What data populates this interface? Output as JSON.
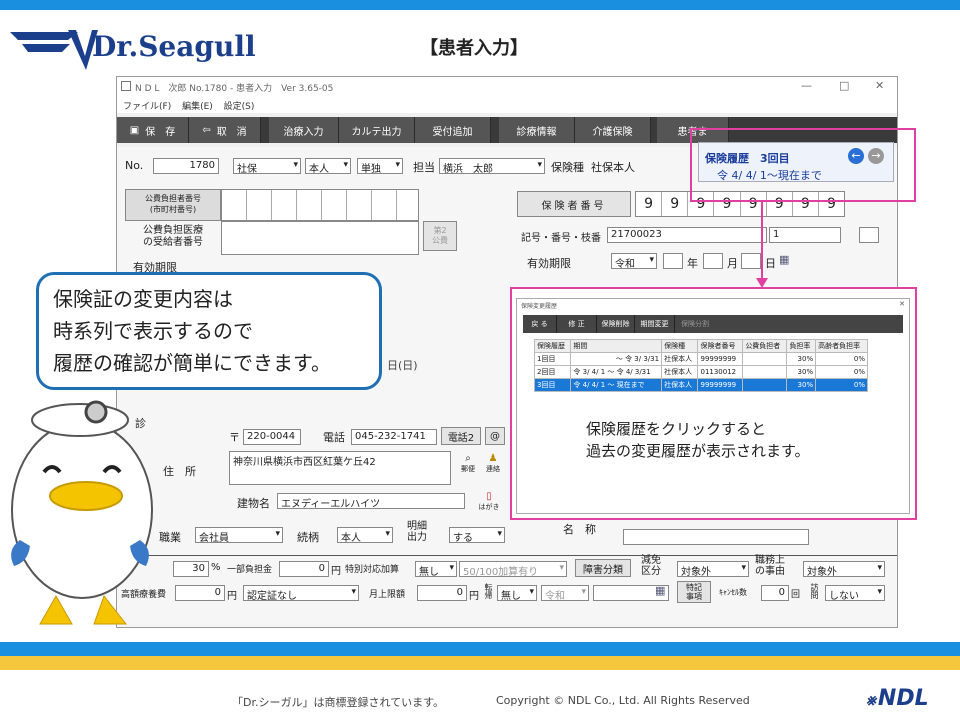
{
  "slide": {
    "title": "【患者入力】",
    "logo": "Dr.Seagull",
    "callout": [
      "保険証の変更内容は",
      "時系列で表示するので",
      "履歴の確認が簡単にできます。"
    ],
    "popup_note": [
      "保険履歴をクリックすると",
      "過去の変更履歴が表示されます。"
    ],
    "footer_left": "「Dr.シーガル」は商標登録されています。",
    "footer_copy": "Copyright © NDL Co., Ltd. All Rights Reserved",
    "footer_logo": "NDL"
  },
  "window": {
    "title": "N D L　次郎 No.1780 - 患者入力　Ver 3.65-05",
    "menu": [
      "ファイル(F)",
      "編集(E)",
      "設定(S)"
    ],
    "controls": [
      "—",
      "□",
      "✕"
    ]
  },
  "toolbar": [
    "保　存",
    "取　消",
    "治療入力",
    "カルテ出力",
    "受付追加",
    "診療情報",
    "介護保険",
    "患者ま"
  ],
  "form": {
    "no_label": "No.",
    "no_value": "1780",
    "insurance_kind": "社保",
    "self_family": "本人",
    "single": "単独",
    "tanto_label": "担当",
    "tanto_value": "横浜　太郎",
    "hokenshu_label": "保険種",
    "hokenshu_value": "社保本人",
    "kohi_no_label": "公費負担者番号\n(市町村番号)",
    "kohi_recipient_label": "公費負担医療\nの受給者番号",
    "kohi2_label": "第2\n公費",
    "yuko_label": "有効期限",
    "hokensha_no_label": "保険者番号",
    "hokensha_digits": [
      "9",
      "9",
      "9",
      "9",
      "9",
      "9",
      "9",
      "9"
    ],
    "kigo_label": "記号・番号・枝番",
    "kigo_value": "21700023",
    "edaban": "1",
    "yukokigen_label": "有効期限",
    "era": "令和",
    "nen": "年",
    "tsuki": "月",
    "hi": "日",
    "date_sun": "日(日)",
    "postal_prefix": "〒",
    "postal_value": "220-0044",
    "tel_label": "電話",
    "tel_value": "045-232-1741",
    "tel2_btn": "電話2",
    "at_btn": "@",
    "address_label": "住　所",
    "address_value": "神奈川県横浜市西区紅葉ケ丘42",
    "yubin_btn": "郵便",
    "renraku_btn": "連絡",
    "building_label": "建物名",
    "building_value": "エヌディーエルハイツ",
    "hagaki_btn": "はがき",
    "shin_label": "診",
    "shokugyo_label": "職業",
    "shokugyo_value": "会社員",
    "zokugara_label": "続柄",
    "zokugara_value": "本人",
    "meisai_label": "明細\n出力",
    "meisai_value": "する",
    "meisho_label": "名　称",
    "futan_pct": "30",
    "pct_label": "%",
    "ichibu_label": "一部負担金",
    "ichibu_value": "0",
    "yen": "円",
    "tokubetsu_label": "特別対応加算",
    "tokubetsu_value": "無し",
    "kasan_value": "50/100加算有り",
    "shogai_btn": "障害分類",
    "gengaku_label": "減免\n区分",
    "gengaku_value": "対象外",
    "shokumu_label": "職務上\nの事由",
    "shokumu_value": "対象外",
    "kogaku_label": "高額療養費",
    "kogaku_value": "0",
    "nintei_value": "認定証なし",
    "gengen_label": "月上限額",
    "gengen_value": "0",
    "tenki_label": "転帰",
    "tenki_value": "無し",
    "era2": "令和",
    "tokki_btn": "特記\n事項",
    "cancel_label": "ｷｬﾝｾﾙ数",
    "cancel_value": "0",
    "kai": "回",
    "homon_label": "訪問",
    "homon_value": "しない"
  },
  "history_box": {
    "title": "保険履歴　3回目",
    "range": "令 4/ 4/ 1～現在まで"
  },
  "popup": {
    "title": "保険変更履歴",
    "buttons": [
      "戻 る",
      "修 正",
      "保険削除",
      "期間変更",
      "保険分割"
    ],
    "columns": [
      "保険履歴",
      "期間",
      "保険種",
      "保険者番号",
      "公費負担者",
      "負担率",
      "高齢者負担率"
    ],
    "rows": [
      [
        "1回目",
        "～ 令 3/ 3/31",
        "社保本人",
        "99999999",
        "",
        "30%",
        "0%"
      ],
      [
        "2回目",
        "令 3/ 4/ 1 ～ 令 4/ 3/31",
        "社保本人",
        "01130012",
        "",
        "30%",
        "0%"
      ],
      [
        "3回目",
        "令 4/ 4/ 1 ～ 現在まで",
        "社保本人",
        "99999999",
        "",
        "30%",
        "0%"
      ]
    ],
    "selected_row": 2
  }
}
